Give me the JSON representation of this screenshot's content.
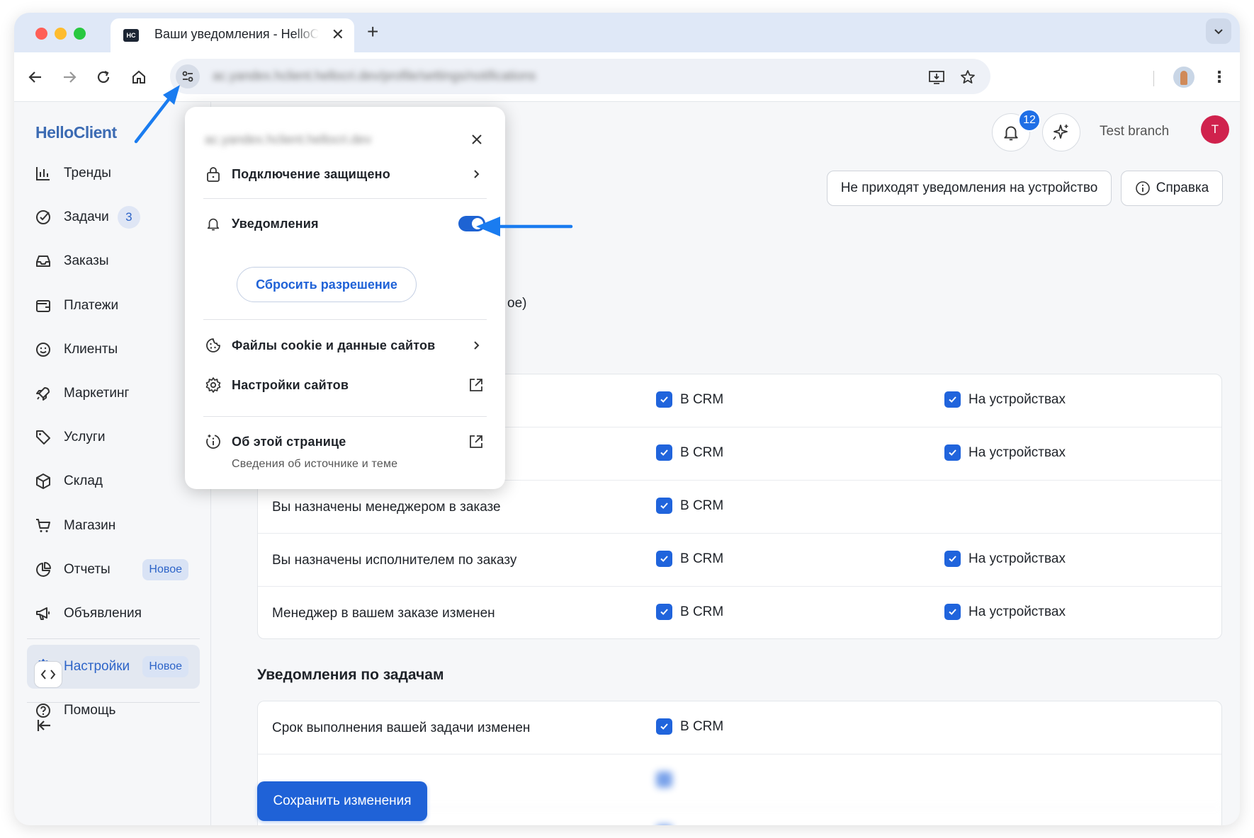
{
  "browser": {
    "tab_title": "Ваши уведомления - HelloClient",
    "tab_favicon": "HC",
    "tab_close": "✕",
    "new_tab": "+",
    "tabs_dropdown": "⌄",
    "url": "ac.yandex.hclient.hellocri.dev/profile/settings/notifications",
    "kebab": "⋮"
  },
  "popup": {
    "domain": "ac.yandex.hclient.hellocri.dev",
    "secure_label": "Подключение защищено",
    "notifications_label": "Уведомления",
    "notifications_enabled": true,
    "reset_label": "Сбросить разрешение",
    "cookies_label": "Файлы cookie и данные сайтов",
    "site_settings_label": "Настройки сайтов",
    "about_label": "Об этой странице",
    "about_sub": "Сведения об источнике и теме"
  },
  "sidebar": {
    "logo": "HelloClient",
    "items": [
      {
        "label": "Тренды",
        "icon": "chart-icon"
      },
      {
        "label": "Задачи",
        "icon": "check-circle-icon",
        "count": "3"
      },
      {
        "label": "Заказы",
        "icon": "inbox-icon"
      },
      {
        "label": "Платежи",
        "icon": "wallet-icon"
      },
      {
        "label": "Клиенты",
        "icon": "smile-icon"
      },
      {
        "label": "Маркетинг",
        "icon": "rocket-icon"
      },
      {
        "label": "Услуги",
        "icon": "tag-icon"
      },
      {
        "label": "Склад",
        "icon": "box-icon"
      },
      {
        "label": "Магазин",
        "icon": "cart-icon"
      },
      {
        "label": "Отчеты",
        "icon": "pie-icon",
        "badge": "Новое"
      },
      {
        "label": "Объявления",
        "icon": "megaphone-icon"
      }
    ],
    "settings": {
      "label": "Настройки",
      "badge": "Новое"
    },
    "help": {
      "label": "Помощь"
    }
  },
  "header": {
    "notif_count": "12",
    "user_name": "Test branch",
    "avatar_letter": "T"
  },
  "main": {
    "devices_button": "Не приходят уведомления на устройство",
    "help_button": "Справка",
    "partial_text": "ое)",
    "crm_label": "В CRM",
    "devices_label": "На устройствах",
    "rows": [
      {
        "label": "",
        "crm": true,
        "devices": true
      },
      {
        "label": "",
        "crm": true,
        "devices": true
      },
      {
        "label": "Вы назначены менеджером в заказе",
        "crm": true,
        "devices": false
      },
      {
        "label": "Вы назначены исполнителем по заказу",
        "crm": true,
        "devices": true
      },
      {
        "label": "Менеджер в вашем заказе изменен",
        "crm": true,
        "devices": true
      }
    ],
    "tasks_section_title": "Уведомления по задачам",
    "task_rows": [
      {
        "label": "Срок выполнения вашей задачи изменен",
        "crm": true
      }
    ],
    "save_button": "Сохранить изменения"
  },
  "colors": {
    "accent": "#1f62d7",
    "avatar": "#d0224d",
    "annotation_arrow": "#1a7cf0"
  }
}
